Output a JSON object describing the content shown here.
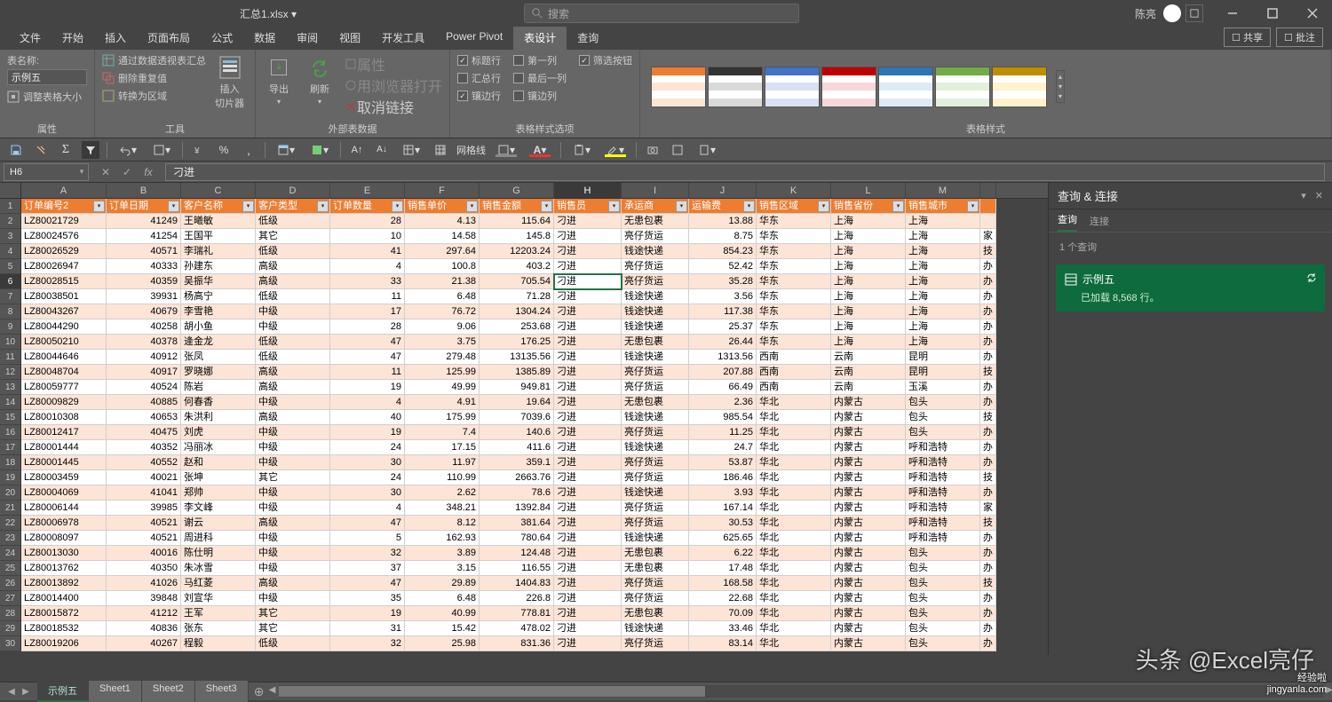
{
  "titlebar": {
    "filename": "汇总1.xlsx ▾",
    "search_placeholder": "搜索",
    "username": "陈亮"
  },
  "menutabs": [
    "文件",
    "开始",
    "插入",
    "页面布局",
    "公式",
    "数据",
    "审阅",
    "视图",
    "开发工具",
    "Power Pivot",
    "表设计",
    "查询"
  ],
  "menutabs_active": "表设计",
  "top_right": {
    "share": "共享",
    "comments": "批注"
  },
  "ribbon": {
    "props": {
      "label": "属性",
      "table_name_label": "表名称:",
      "table_name": "示例五",
      "resize": "调整表格大小"
    },
    "tools": {
      "label": "工具",
      "pivot": "通过数据透视表汇总",
      "dedupe": "删除重复值",
      "range": "转换为区域",
      "slicer": "插入\n切片器"
    },
    "ext": {
      "label": "外部表数据",
      "export": "导出",
      "refresh": "刷新",
      "props": "属性",
      "browser": "用浏览器打开",
      "unlink": "取消链接"
    },
    "style_opts": {
      "label": "表格样式选项",
      "header_row": "标题行",
      "first_col": "第一列",
      "filter_btn": "筛选按钮",
      "total_row": "汇总行",
      "last_col": "最后一列",
      "banded_rows": "镶边行",
      "banded_cols": "镶边列"
    },
    "styles": {
      "label": "表格样式"
    }
  },
  "qat2": {
    "gridlines": "网格线"
  },
  "formula_bar": {
    "cell_ref": "H6",
    "formula": "刁进"
  },
  "columns": [
    {
      "letter": "A",
      "label": "订单编号2",
      "w": 96
    },
    {
      "letter": "B",
      "label": "订单日期",
      "w": 84
    },
    {
      "letter": "C",
      "label": "客户名称",
      "w": 84
    },
    {
      "letter": "D",
      "label": "客户类型",
      "w": 84
    },
    {
      "letter": "E",
      "label": "订单数量",
      "w": 84
    },
    {
      "letter": "F",
      "label": "销售单价",
      "w": 84
    },
    {
      "letter": "G",
      "label": "销售金额",
      "w": 84
    },
    {
      "letter": "H",
      "label": "销售员",
      "w": 76
    },
    {
      "letter": "I",
      "label": "承运商",
      "w": 76
    },
    {
      "letter": "J",
      "label": "运输费",
      "w": 76
    },
    {
      "letter": "K",
      "label": "销售区域",
      "w": 84
    },
    {
      "letter": "L",
      "label": "销售省份",
      "w": 84
    },
    {
      "letter": "M",
      "label": "销售城市",
      "w": 84
    }
  ],
  "active_col": "H",
  "active_row": 6,
  "data_rows": [
    [
      "LZ80021729",
      "41249",
      "王曦敏",
      "低级",
      "28",
      "4.13",
      "115.64",
      "刁进",
      "无患包裹",
      "13.88",
      "华东",
      "上海",
      "上海"
    ],
    [
      "LZ80024576",
      "41254",
      "王国平",
      "其它",
      "10",
      "14.58",
      "145.8",
      "刁进",
      "亮仔货运",
      "8.75",
      "华东",
      "上海",
      "上海"
    ],
    [
      "LZ80026529",
      "40571",
      "李瑞礼",
      "低级",
      "41",
      "297.64",
      "12203.24",
      "刁进",
      "钱途快递",
      "854.23",
      "华东",
      "上海",
      "上海"
    ],
    [
      "LZ80026947",
      "40333",
      "孙建东",
      "高级",
      "4",
      "100.8",
      "403.2",
      "刁进",
      "亮仔货运",
      "52.42",
      "华东",
      "上海",
      "上海"
    ],
    [
      "LZ80028515",
      "40359",
      "吴振华",
      "高级",
      "33",
      "21.38",
      "705.54",
      "刁进",
      "亮仔货运",
      "35.28",
      "华东",
      "上海",
      "上海"
    ],
    [
      "LZ80038501",
      "39931",
      "杨高宁",
      "低级",
      "11",
      "6.48",
      "71.28",
      "刁进",
      "钱途快递",
      "3.56",
      "华东",
      "上海",
      "上海"
    ],
    [
      "LZ80043267",
      "40679",
      "李雪艳",
      "中级",
      "17",
      "76.72",
      "1304.24",
      "刁进",
      "钱途快递",
      "117.38",
      "华东",
      "上海",
      "上海"
    ],
    [
      "LZ80044290",
      "40258",
      "胡小鱼",
      "中级",
      "28",
      "9.06",
      "253.68",
      "刁进",
      "钱途快递",
      "25.37",
      "华东",
      "上海",
      "上海"
    ],
    [
      "LZ80050210",
      "40378",
      "逄金龙",
      "低级",
      "47",
      "3.75",
      "176.25",
      "刁进",
      "无患包裹",
      "26.44",
      "华东",
      "上海",
      "上海"
    ],
    [
      "LZ80044646",
      "40912",
      "张凤",
      "低级",
      "47",
      "279.48",
      "13135.56",
      "刁进",
      "钱途快递",
      "1313.56",
      "西南",
      "云南",
      "昆明"
    ],
    [
      "LZ80048704",
      "40917",
      "罗晓娜",
      "高级",
      "11",
      "125.99",
      "1385.89",
      "刁进",
      "亮仔货运",
      "207.88",
      "西南",
      "云南",
      "昆明"
    ],
    [
      "LZ80059777",
      "40524",
      "陈岩",
      "高级",
      "19",
      "49.99",
      "949.81",
      "刁进",
      "亮仔货运",
      "66.49",
      "西南",
      "云南",
      "玉溪"
    ],
    [
      "LZ80009829",
      "40885",
      "何春香",
      "中级",
      "4",
      "4.91",
      "19.64",
      "刁进",
      "无患包裹",
      "2.36",
      "华北",
      "内蒙古",
      "包头"
    ],
    [
      "LZ80010308",
      "40653",
      "朱洪利",
      "高级",
      "40",
      "175.99",
      "7039.6",
      "刁进",
      "钱途快递",
      "985.54",
      "华北",
      "内蒙古",
      "包头"
    ],
    [
      "LZ80012417",
      "40475",
      "刘虎",
      "中级",
      "19",
      "7.4",
      "140.6",
      "刁进",
      "亮仔货运",
      "11.25",
      "华北",
      "内蒙古",
      "包头"
    ],
    [
      "LZ80001444",
      "40352",
      "冯丽冰",
      "中级",
      "24",
      "17.15",
      "411.6",
      "刁进",
      "钱途快递",
      "24.7",
      "华北",
      "内蒙古",
      "呼和浩特"
    ],
    [
      "LZ80001445",
      "40552",
      "赵和",
      "中级",
      "30",
      "11.97",
      "359.1",
      "刁进",
      "亮仔货运",
      "53.87",
      "华北",
      "内蒙古",
      "呼和浩特"
    ],
    [
      "LZ80003459",
      "40021",
      "张坤",
      "其它",
      "24",
      "110.99",
      "2663.76",
      "刁进",
      "亮仔货运",
      "186.46",
      "华北",
      "内蒙古",
      "呼和浩特"
    ],
    [
      "LZ80004069",
      "41041",
      "郑帅",
      "中级",
      "30",
      "2.62",
      "78.6",
      "刁进",
      "钱途快递",
      "3.93",
      "华北",
      "内蒙古",
      "呼和浩特"
    ],
    [
      "LZ80006144",
      "39985",
      "李文峰",
      "中级",
      "4",
      "348.21",
      "1392.84",
      "刁进",
      "亮仔货运",
      "167.14",
      "华北",
      "内蒙古",
      "呼和浩特"
    ],
    [
      "LZ80006978",
      "40521",
      "谢云",
      "高级",
      "47",
      "8.12",
      "381.64",
      "刁进",
      "亮仔货运",
      "30.53",
      "华北",
      "内蒙古",
      "呼和浩特"
    ],
    [
      "LZ80008097",
      "40521",
      "周进科",
      "中级",
      "5",
      "162.93",
      "780.64",
      "刁进",
      "钱途快递",
      "625.65",
      "华北",
      "内蒙古",
      "呼和浩特"
    ],
    [
      "LZ80013030",
      "40016",
      "陈仕明",
      "中级",
      "32",
      "3.89",
      "124.48",
      "刁进",
      "无患包裹",
      "6.22",
      "华北",
      "内蒙古",
      "包头"
    ],
    [
      "LZ80013762",
      "40350",
      "朱冰雪",
      "中级",
      "37",
      "3.15",
      "116.55",
      "刁进",
      "无患包裹",
      "17.48",
      "华北",
      "内蒙古",
      "包头"
    ],
    [
      "LZ80013892",
      "41026",
      "马红菱",
      "高级",
      "47",
      "29.89",
      "1404.83",
      "刁进",
      "亮仔货运",
      "168.58",
      "华北",
      "内蒙古",
      "包头"
    ],
    [
      "LZ80014400",
      "39848",
      "刘宣华",
      "中级",
      "35",
      "6.48",
      "226.8",
      "刁进",
      "亮仔货运",
      "22.68",
      "华北",
      "内蒙古",
      "包头"
    ],
    [
      "LZ80015872",
      "41212",
      "王军",
      "其它",
      "19",
      "40.99",
      "778.81",
      "刁进",
      "无患包裹",
      "70.09",
      "华北",
      "内蒙古",
      "包头"
    ],
    [
      "LZ80018532",
      "40836",
      "张东",
      "其它",
      "31",
      "15.42",
      "478.02",
      "刁进",
      "钱途快递",
      "33.46",
      "华北",
      "内蒙古",
      "包头"
    ],
    [
      "LZ80019206",
      "40267",
      "程毅",
      "低级",
      "32",
      "25.98",
      "831.36",
      "刁进",
      "亮仔货运",
      "83.14",
      "华北",
      "内蒙古",
      "包头"
    ]
  ],
  "numeric_cols": [
    1,
    4,
    5,
    6,
    9
  ],
  "right_clip": [
    "",
    "家",
    "技",
    "办",
    "办",
    "办",
    "办",
    "办",
    "办",
    "办",
    "技",
    "办",
    "办",
    "技",
    "办",
    "办",
    "办",
    "技",
    "办",
    "家",
    "技",
    "办",
    "办",
    "办",
    "技",
    "办",
    "办",
    "办",
    "办"
  ],
  "query_pane": {
    "title": "查询 & 连接",
    "tab_query": "查询",
    "tab_connect": "连接",
    "count": "1 个查询",
    "item_name": "示例五",
    "item_status": "已加载 8,568 行。"
  },
  "sheets": [
    "示例五",
    "Sheet1",
    "Sheet2",
    "Sheet3"
  ],
  "active_sheet": "示例五",
  "watermark": "头条 @Excel亮仔",
  "watermark2": "经验啦\njingyanla.com"
}
